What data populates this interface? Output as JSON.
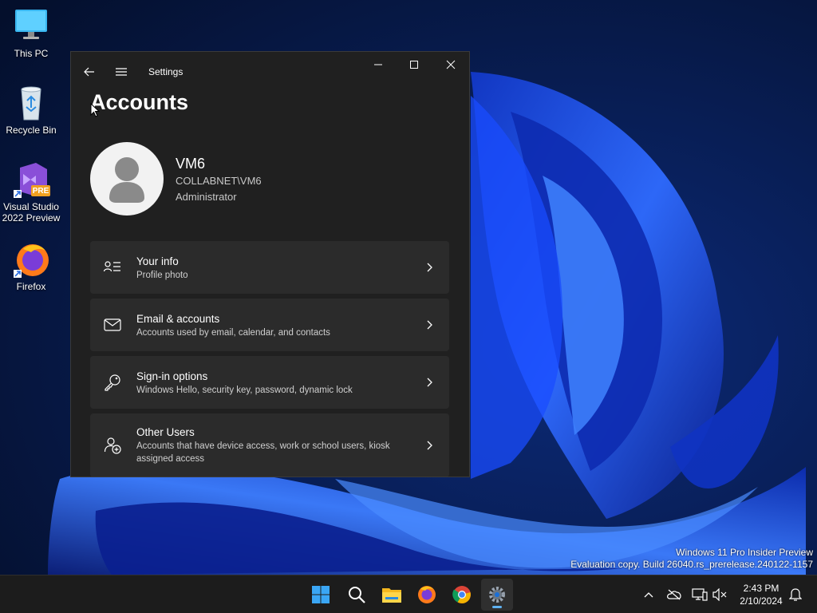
{
  "desktop": {
    "icons": [
      {
        "label": "This PC",
        "icon": "monitor-icon"
      },
      {
        "label": "Recycle Bin",
        "icon": "recycle-bin-icon"
      },
      {
        "label": "Visual Studio 2022 Preview",
        "icon": "visual-studio-icon",
        "badge": "PRE"
      },
      {
        "label": "Firefox",
        "icon": "firefox-icon"
      }
    ]
  },
  "window": {
    "title": "Settings",
    "page_title": "Accounts",
    "profile": {
      "name": "VM6",
      "domain": "COLLABNET\\VM6",
      "role": "Administrator"
    },
    "items": [
      {
        "title": "Your info",
        "description": "Profile photo",
        "icon": "contact-card-icon"
      },
      {
        "title": "Email & accounts",
        "description": "Accounts used by email, calendar, and contacts",
        "icon": "mail-icon"
      },
      {
        "title": "Sign-in options",
        "description": "Windows Hello, security key, password, dynamic lock",
        "icon": "key-icon"
      },
      {
        "title": "Other Users",
        "description": "Accounts that have device access, work or school users, kiosk assigned access",
        "icon": "add-user-icon"
      }
    ]
  },
  "watermark": {
    "line1": "Windows 11 Pro Insider Preview",
    "line2": "Evaluation copy. Build 26040.rs_prerelease.240122-1157"
  },
  "taskbar": {
    "apps": [
      "start-icon",
      "search-icon",
      "file-explorer-icon",
      "firefox-icon",
      "chrome-icon",
      "settings-icon"
    ],
    "active_app": "settings-icon",
    "time": "2:43 PM",
    "date": "2/10/2024"
  },
  "colors": {
    "window_bg": "#202020",
    "card_bg": "#2b2b2b",
    "taskbar_bg": "#1c1c1c",
    "accent": "#5fb2f2",
    "wallpaper_blue": "#1a4cff"
  }
}
